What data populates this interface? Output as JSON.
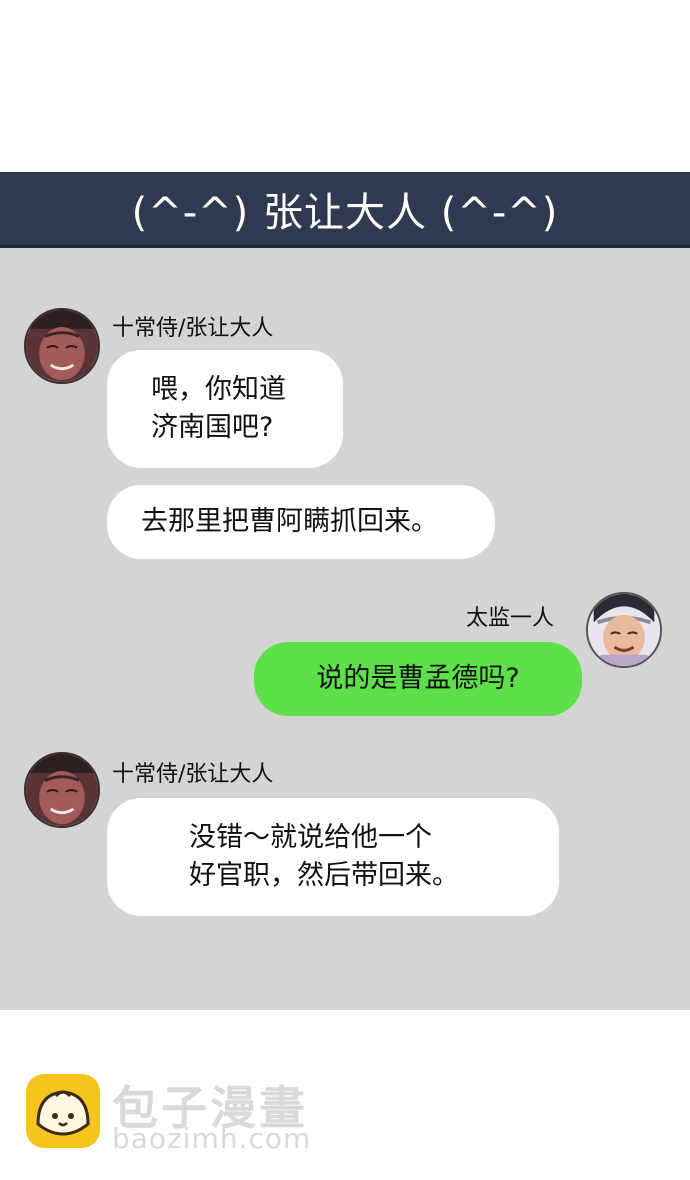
{
  "header": {
    "title": "(^-^) 张让大人 (^-^)"
  },
  "messages": [
    {
      "sender": "十常侍/张让大人",
      "side": "left",
      "lines": [
        "喂，你知道",
        "济南国吧?"
      ]
    },
    {
      "sender": "十常侍/张让大人",
      "side": "left",
      "lines": [
        "去那里把曹阿瞒抓回来。"
      ]
    },
    {
      "sender": "太监一人",
      "side": "right",
      "lines": [
        "说的是曹孟德吗?"
      ]
    },
    {
      "sender": "十常侍/张让大人",
      "side": "left",
      "lines": [
        "没错～就说给他一个",
        "好官职，然后带回来。"
      ]
    }
  ],
  "watermark": {
    "brand": "包子漫畫",
    "url": "baozimh.com"
  },
  "colors": {
    "title_bar": "#2f3a51",
    "chat_background": "#d4d4d4",
    "bubble_left": "#ffffff",
    "bubble_right": "#5ee04a",
    "logo": "#f6c51b"
  }
}
